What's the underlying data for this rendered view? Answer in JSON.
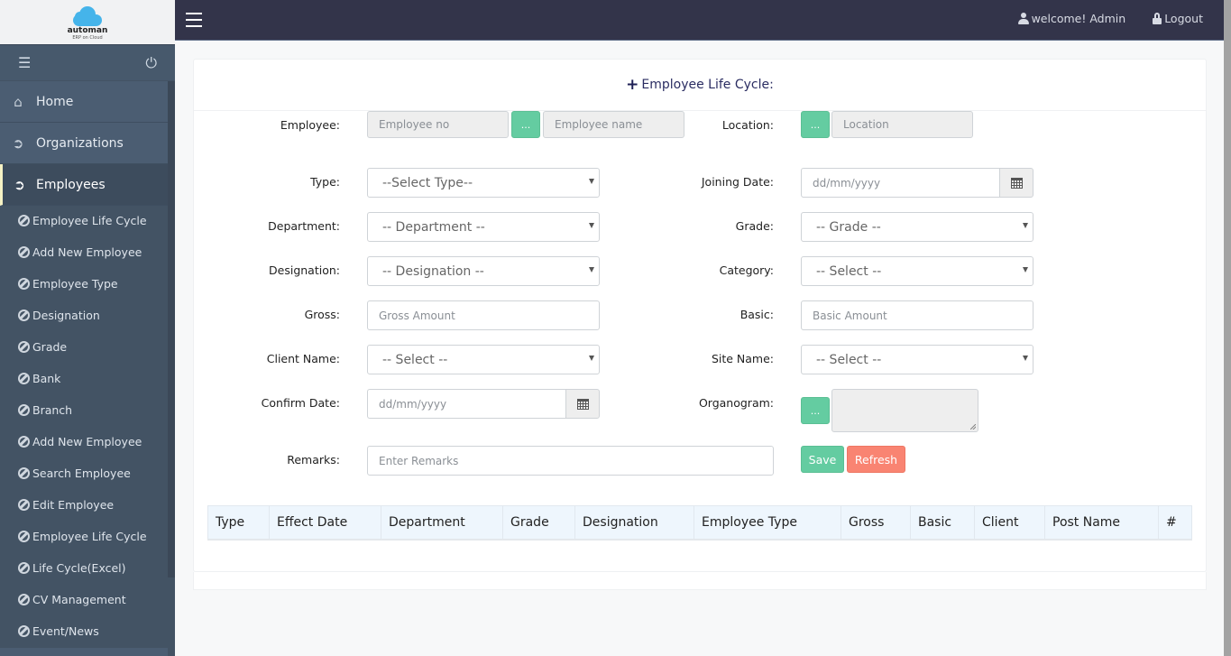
{
  "brand": {
    "name": "automan",
    "tagline": "ERP on Cloud"
  },
  "topbar": {
    "welcome": "welcome! Admin",
    "logout": "Logout"
  },
  "sidebar": {
    "main_items": [
      {
        "label": "Home",
        "icon": "home-icon"
      },
      {
        "label": "Organizations",
        "icon": "arrow-circle-right-icon"
      },
      {
        "label": "Employees",
        "icon": "arrow-circle-right-icon",
        "active": true
      }
    ],
    "sub_items": [
      "Employee Life Cycle",
      "Add New Employee",
      "Employee Type",
      "Designation",
      "Grade",
      "Bank",
      "Branch",
      "Add New Employee",
      "Search Employee",
      "Edit Employee",
      "Employee Life Cycle",
      "Life Cycle(Excel)",
      "CV Management",
      "Event/News"
    ]
  },
  "panel": {
    "title": "Employee Life Cycle:",
    "form": {
      "employee": {
        "label": "Employee:",
        "no_placeholder": "Employee no",
        "name_placeholder": "Employee name",
        "lookup": "..."
      },
      "location": {
        "label": "Location:",
        "placeholder": "Location",
        "lookup": "..."
      },
      "type": {
        "label": "Type:",
        "selected": "--Select Type--"
      },
      "joining_date": {
        "label": "Joining Date:",
        "placeholder": "dd/mm/yyyy"
      },
      "department": {
        "label": "Department:",
        "selected": "-- Department --"
      },
      "grade": {
        "label": "Grade:",
        "selected": "-- Grade --"
      },
      "designation": {
        "label": "Designation:",
        "selected": "-- Designation --"
      },
      "category": {
        "label": "Category:",
        "selected": "-- Select --"
      },
      "gross": {
        "label": "Gross:",
        "placeholder": "Gross Amount"
      },
      "basic": {
        "label": "Basic:",
        "placeholder": "Basic Amount"
      },
      "client_name": {
        "label": "Client Name:",
        "selected": "-- Select --"
      },
      "site_name": {
        "label": "Site Name:",
        "selected": "-- Select --"
      },
      "confirm_date": {
        "label": "Confirm Date:",
        "placeholder": "dd/mm/yyyy"
      },
      "organogram": {
        "label": "Organogram:",
        "lookup": "...",
        "value": ""
      },
      "remarks": {
        "label": "Remarks:",
        "placeholder": "Enter Remarks"
      },
      "save": "Save",
      "refresh": "Refresh"
    },
    "table": {
      "columns": [
        "Type",
        "Effect Date",
        "Department",
        "Grade",
        "Designation",
        "Employee Type",
        "Gross",
        "Basic",
        "Client",
        "Post Name",
        "#"
      ],
      "rows": []
    }
  },
  "colors": {
    "accent_green": "#64cca1",
    "accent_red": "#f98472",
    "topbar": "#33344a",
    "sidebar": "#435364"
  }
}
